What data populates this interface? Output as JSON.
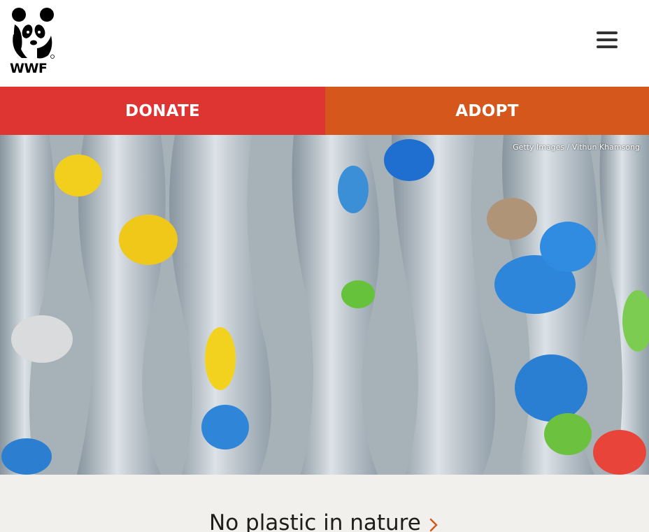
{
  "header": {
    "logo_text": "WWF",
    "menu_icon": "hamburger-menu-icon"
  },
  "cta": {
    "donate_label": "DONATE",
    "adopt_label": "ADOPT",
    "donate_color": "#df3532",
    "adopt_color": "#d5571b"
  },
  "hero": {
    "credit": "Getty Images / Vithun Khamsong"
  },
  "section": {
    "title": "No plastic in nature",
    "chevron_icon": "chevron-right-icon",
    "accent": "#d5571b"
  }
}
